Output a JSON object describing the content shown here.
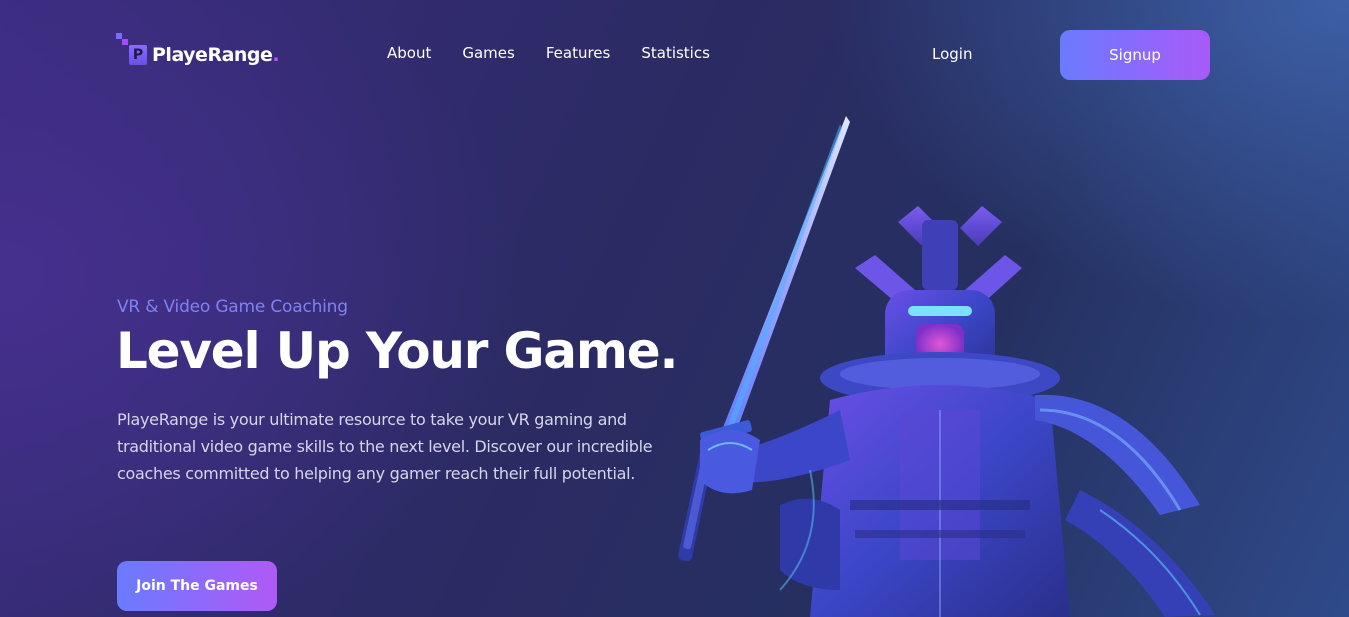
{
  "brand": {
    "mark_letter": "P",
    "name": "PlayeRange",
    "dot": "."
  },
  "nav": {
    "items": [
      {
        "label": "About"
      },
      {
        "label": "Games"
      },
      {
        "label": "Features"
      },
      {
        "label": "Statistics"
      }
    ]
  },
  "auth": {
    "login_label": "Login",
    "signup_label": "Signup"
  },
  "hero": {
    "eyebrow": "VR & Video Game Coaching",
    "headline": "Level Up Your Game.",
    "description": "PlayeRange is your ultimate resource to take your VR gaming and traditional video game skills to the next level. Discover our incredible coaches committed to helping any gamer reach their full potential.",
    "cta_label": "Join The Games",
    "illustration": "robot-samurai-illustration"
  },
  "colors": {
    "accent_start": "#6a7bff",
    "accent_end": "#a85af7",
    "eyebrow": "#7e82f2",
    "background": "#2b2b63"
  }
}
